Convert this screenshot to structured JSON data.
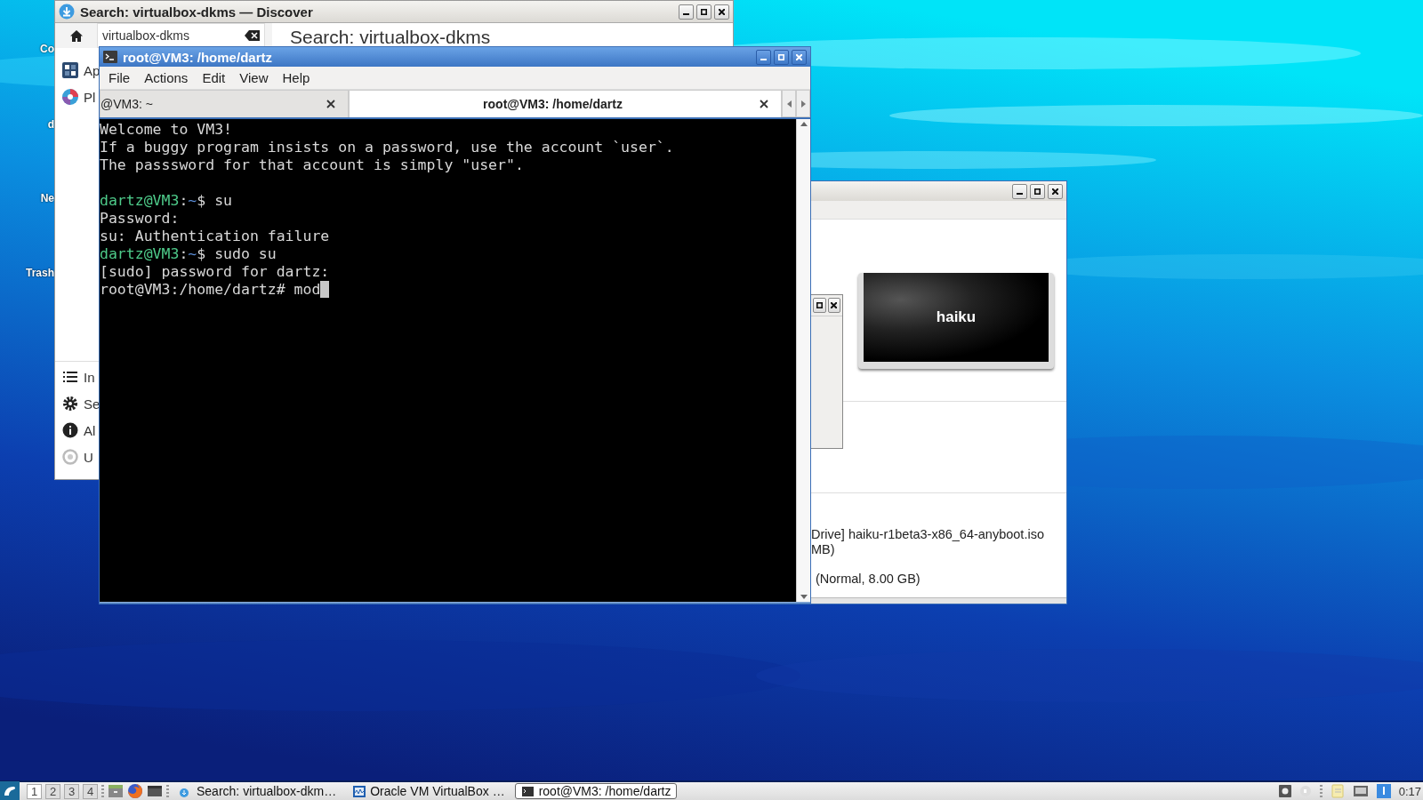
{
  "desktop": {
    "icons": [
      {
        "label": "Co"
      },
      {
        "label": "d"
      },
      {
        "label": "Ne"
      },
      {
        "label": "Trash"
      }
    ]
  },
  "discover": {
    "title": "Search: virtualbox-dkms — Discover",
    "search": {
      "value": "virtualbox-dkms"
    },
    "heading": "Search: virtualbox-dkms",
    "nav_top": [
      {
        "kind": "apps",
        "label": "Ap"
      },
      {
        "kind": "plasma",
        "label": "Pl"
      }
    ],
    "nav_bottom": [
      {
        "kind": "installed",
        "label": "In"
      },
      {
        "kind": "settings",
        "label": "Se"
      },
      {
        "kind": "about",
        "label": "Al"
      },
      {
        "kind": "update",
        "label": "U"
      }
    ]
  },
  "terminal": {
    "title": "root@VM3: /home/dartz",
    "menu": [
      "File",
      "Actions",
      "Edit",
      "View",
      "Help"
    ],
    "tabs": [
      {
        "label": "@VM3: ~",
        "selected": false
      },
      {
        "label": "root@VM3: /home/dartz",
        "selected": true
      }
    ],
    "lines": [
      {
        "kind": "text",
        "cursor": false,
        "segments": [
          {
            "kind": "plain",
            "text": "Welcome to VM3!"
          }
        ]
      },
      {
        "kind": "text",
        "cursor": false,
        "segments": [
          {
            "kind": "plain",
            "text": "If a buggy program insists on a password, use the account `user`."
          }
        ]
      },
      {
        "kind": "text",
        "cursor": false,
        "segments": [
          {
            "kind": "plain",
            "text": "The passsword for that account is simply \"user\"."
          }
        ]
      },
      {
        "kind": "blank",
        "cursor": false
      },
      {
        "kind": "text",
        "cursor": false,
        "segments": [
          {
            "kind": "user",
            "text": "dartz@VM3"
          },
          {
            "kind": "plain",
            "text": ":"
          },
          {
            "kind": "path",
            "text": "~"
          },
          {
            "kind": "plain",
            "text": "$ su"
          }
        ]
      },
      {
        "kind": "text",
        "cursor": false,
        "segments": [
          {
            "kind": "plain",
            "text": "Password:"
          }
        ]
      },
      {
        "kind": "text",
        "cursor": false,
        "segments": [
          {
            "kind": "plain",
            "text": "su: Authentication failure"
          }
        ]
      },
      {
        "kind": "text",
        "cursor": false,
        "segments": [
          {
            "kind": "user",
            "text": "dartz@VM3"
          },
          {
            "kind": "plain",
            "text": ":"
          },
          {
            "kind": "path",
            "text": "~"
          },
          {
            "kind": "plain",
            "text": "$ sudo su"
          }
        ]
      },
      {
        "kind": "text",
        "cursor": false,
        "segments": [
          {
            "kind": "plain",
            "text": "[sudo] password for dartz:"
          }
        ]
      },
      {
        "kind": "text",
        "cursor": true,
        "segments": [
          {
            "kind": "plain",
            "text": "root@VM3:/home/dartz# mod"
          }
        ]
      }
    ]
  },
  "virtualbox": {
    "preview": {
      "text": "haiku"
    },
    "details": [
      "Drive] haiku-r1beta3-x86_64-anyboot.iso",
      "MB)",
      "(Normal, 8.00 GB)"
    ]
  },
  "taskbar": {
    "workspaces": [
      {
        "label": "1",
        "selected": true
      },
      {
        "label": "2",
        "selected": false
      },
      {
        "label": "3",
        "selected": false
      },
      {
        "label": "4",
        "selected": false
      }
    ],
    "launchers": [
      {
        "kind": "files"
      },
      {
        "kind": "firefox"
      },
      {
        "kind": "terminal"
      }
    ],
    "tasks": [
      {
        "kind": "discover",
        "label": "Search: virtualbox-dkm…",
        "selected": false
      },
      {
        "kind": "virtualbox",
        "label": "Oracle VM VirtualBox …",
        "selected": false
      },
      {
        "kind": "terminal",
        "label": "root@VM3: /home/dartz",
        "selected": true
      }
    ],
    "clock": "0:17"
  }
}
